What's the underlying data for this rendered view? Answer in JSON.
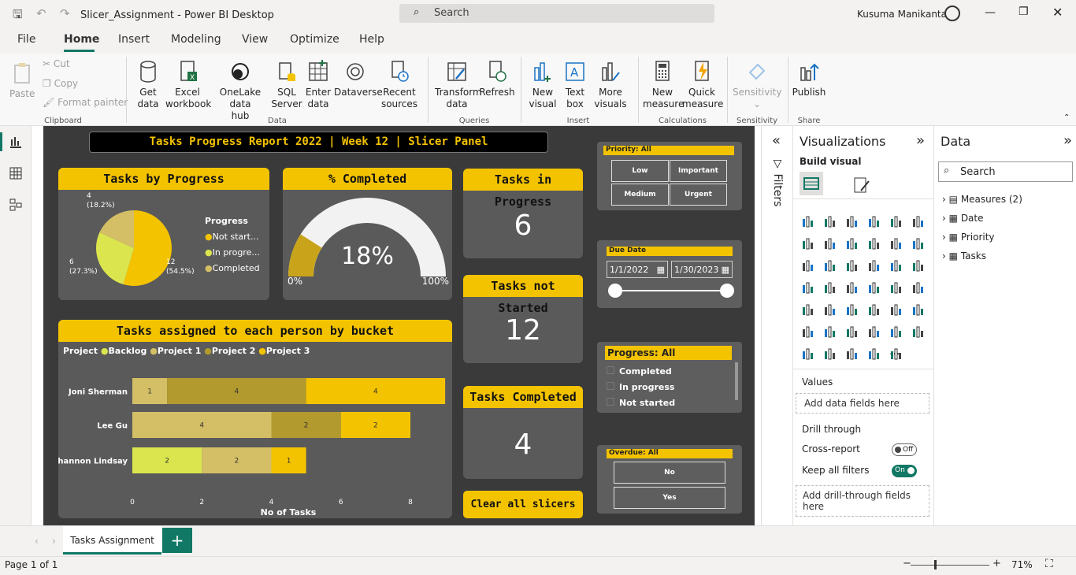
{
  "window": {
    "title": "Slicer_Assignment - Power BI Desktop",
    "search_placeholder": "Search",
    "user": "Kusuma Manikanta"
  },
  "menu": [
    "File",
    "Home",
    "Insert",
    "Modeling",
    "View",
    "Optimize",
    "Help"
  ],
  "ribbon": {
    "clipboard": {
      "paste": "Paste",
      "cut": "Cut",
      "copy": "Copy",
      "format_painter": "Format painter",
      "group": "Clipboard"
    },
    "data": {
      "get_data": [
        "Get",
        "data"
      ],
      "excel": [
        "Excel",
        "workbook"
      ],
      "onelake": [
        "OneLake data",
        "hub"
      ],
      "sql": [
        "SQL",
        "Server"
      ],
      "enter": [
        "Enter",
        "data"
      ],
      "dataverse": "Dataverse",
      "recent": [
        "Recent",
        "sources"
      ],
      "group": "Data"
    },
    "queries": {
      "transform": [
        "Transform",
        "data"
      ],
      "refresh": "Refresh",
      "group": "Queries"
    },
    "insert": {
      "new_visual": [
        "New",
        "visual"
      ],
      "text_box": [
        "Text",
        "box"
      ],
      "more": [
        "More",
        "visuals"
      ],
      "group": "Insert"
    },
    "calculations": {
      "new_measure": [
        "New",
        "measure"
      ],
      "quick_measure": [
        "Quick",
        "measure"
      ],
      "group": "Calculations"
    },
    "sensitivity": {
      "label": "Sensitivity",
      "group": "Sensitivity"
    },
    "share": {
      "publish": "Publish",
      "group": "Share"
    }
  },
  "report": {
    "title": "Tasks Progress Report 2022 | Week 12 | Slicer Panel",
    "pie": {
      "title": "Tasks by Progress",
      "legend_title": "Progress",
      "legend": [
        "Not start...",
        "In progre...",
        "Completed"
      ],
      "labels": [
        {
          "count": "12",
          "pct": "(54.5%)"
        },
        {
          "count": "6",
          "pct": "(27.3%)"
        },
        {
          "count": "4",
          "pct": "(18.2%)"
        }
      ]
    },
    "gauge": {
      "title": "% Completed",
      "value": "18%",
      "min": "0%",
      "max": "100%",
      "fraction": 0.18
    },
    "kpi": [
      {
        "title": "Tasks in Progress",
        "value": "6"
      },
      {
        "title": "Tasks not Started",
        "value": "12"
      },
      {
        "title": "Tasks Completed",
        "value": "4"
      }
    ],
    "clear_button": "Clear all slicers",
    "bar": {
      "title": "Tasks assigned to each person by bucket",
      "legend_title": "Project",
      "legend": [
        "Backlog",
        "Project 1",
        "Project 2",
        "Project 3"
      ],
      "xlabel": "No of Tasks"
    },
    "slicers": {
      "priority": {
        "header": "Priority: All",
        "options": [
          "Low",
          "Important",
          "Medium",
          "Urgent"
        ]
      },
      "due_date": {
        "header": "Due Date",
        "start": "1/1/2022",
        "end": "1/30/2023"
      },
      "progress": {
        "header": "Progress: All",
        "options": [
          "Completed",
          "In progress",
          "Not started"
        ]
      },
      "overdue": {
        "header": "Overdue: All",
        "options": [
          "No",
          "Yes"
        ]
      }
    }
  },
  "chart_data": [
    {
      "type": "pie",
      "title": "Tasks by Progress",
      "categories": [
        "Not started",
        "In progress",
        "Completed"
      ],
      "values": [
        12,
        6,
        4
      ],
      "percent": [
        54.5,
        27.3,
        18.2
      ],
      "colors": [
        "#f4c300",
        "#dbe64e",
        "#d4bf66"
      ]
    },
    {
      "type": "bar",
      "title": "Tasks assigned to each person by bucket",
      "xlabel": "No of Tasks",
      "categories": [
        "Joni Sherman",
        "Lee Gu",
        "Shannon Lindsay"
      ],
      "xlim": [
        0,
        8
      ],
      "xticks": [
        "0",
        "2",
        "4",
        "6",
        "8"
      ],
      "series": [
        {
          "name": "Backlog",
          "values": [
            0,
            0,
            2
          ],
          "color": "#dbe64e"
        },
        {
          "name": "Project 1",
          "values": [
            1,
            4,
            2
          ],
          "color": "#d4bf66"
        },
        {
          "name": "Project 2",
          "values": [
            4,
            2,
            0
          ],
          "color": "#b39a2f"
        },
        {
          "name": "Project 3",
          "values": [
            4,
            2,
            1
          ],
          "color": "#f4c300"
        }
      ]
    }
  ],
  "filters": {
    "label": "Filters"
  },
  "visualizations": {
    "title": "Visualizations",
    "build": "Build visual",
    "values": "Values",
    "add_data": "Add data fields here",
    "drill": "Drill through",
    "cross": "Cross-report",
    "cross_state": "Off",
    "keep": "Keep all filters",
    "keep_state": "On",
    "add_drill": "Add drill-through fields here",
    "more": "..."
  },
  "data_pane": {
    "title": "Data",
    "search": "Search",
    "items": [
      "Measures (2)",
      "Date",
      "Priority",
      "Tasks"
    ]
  },
  "tabs": {
    "page": "Tasks Assignment",
    "add": "+"
  },
  "status": {
    "page": "Page 1 of 1",
    "zoom": "71%"
  }
}
